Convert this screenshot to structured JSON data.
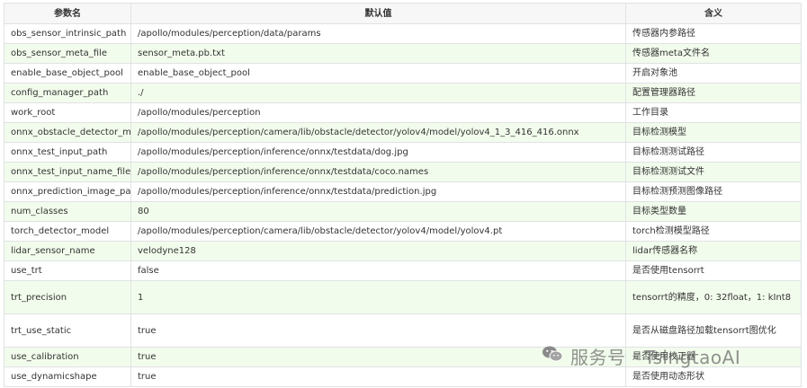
{
  "table": {
    "headers": [
      "参数名",
      "默认值",
      "含义"
    ],
    "rows": [
      [
        "obs_sensor_intrinsic_path",
        "/apollo/modules/perception/data/params",
        "传感器内参路径"
      ],
      [
        "obs_sensor_meta_file",
        "sensor_meta.pb.txt",
        "传感器meta文件名"
      ],
      [
        "enable_base_object_pool",
        "enable_base_object_pool",
        "开启对象池"
      ],
      [
        "config_manager_path",
        "./",
        "配置管理器路径"
      ],
      [
        "work_root",
        "/apollo/modules/perception",
        "工作目录"
      ],
      [
        "onnx_obstacle_detector_model",
        "/apollo/modules/perception/camera/lib/obstacle/detector/yolov4/model/yolov4_1_3_416_416.onnx",
        "目标检测模型"
      ],
      [
        "onnx_test_input_path",
        "/apollo/modules/perception/inference/onnx/testdata/dog.jpg",
        "目标检测测试路径"
      ],
      [
        "onnx_test_input_name_file",
        "/apollo/modules/perception/inference/onnx/testdata/coco.names",
        "目标检测测试文件"
      ],
      [
        "onnx_prediction_image_path",
        "/apollo/modules/perception/inference/onnx/testdata/prediction.jpg",
        "目标检测预测图像路径"
      ],
      [
        "num_classes",
        "80",
        "目标类型数量"
      ],
      [
        "torch_detector_model",
        "/apollo/modules/perception/camera/lib/obstacle/detector/yolov4/model/yolov4.pt",
        "torch检测模型路径"
      ],
      [
        "lidar_sensor_name",
        "velodyne128",
        "lidar传感器名称"
      ],
      [
        "use_trt",
        "false",
        "是否使用tensorrt"
      ],
      [
        "trt_precision",
        "1",
        "tensorrt的精度，0: 32float，1: kInt8"
      ],
      [
        "trt_use_static",
        "true",
        "是否从磁盘路径加载tensorrt图优化"
      ],
      [
        "use_calibration",
        "true",
        "是否使用校正器"
      ],
      [
        "use_dynamicshape",
        "true",
        "是否使用动态形状"
      ]
    ]
  },
  "watermark": {
    "text": "服务号 · TsingtaoAI",
    "icon": "wechat-icon",
    "color": "#6e6e6e"
  }
}
